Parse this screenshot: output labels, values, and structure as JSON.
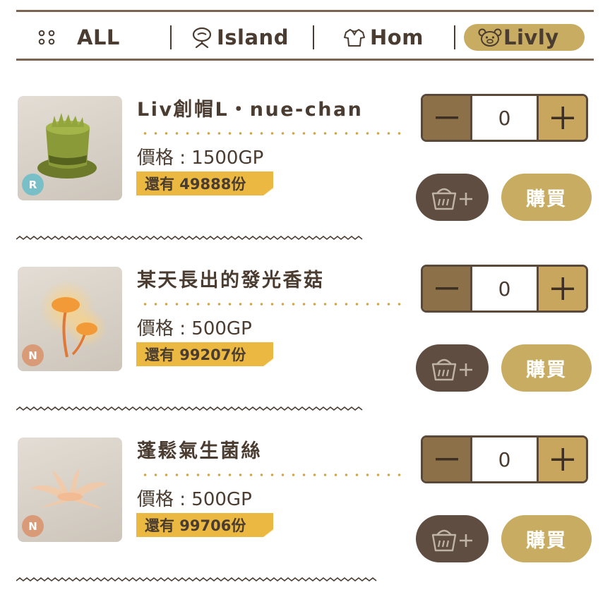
{
  "tabs": [
    {
      "label": "ALL",
      "icon": "dots-grid-icon",
      "active": false
    },
    {
      "label": "Island",
      "icon": "tree-icon",
      "active": false
    },
    {
      "label": "Hom",
      "icon": "shirt-icon",
      "active": false
    },
    {
      "label": "Livly",
      "icon": "livly-face-icon",
      "active": true
    }
  ],
  "items": [
    {
      "name": "Liv創帽L・nue-chan",
      "price": "價格 : 1500GP",
      "stock": "還有 49888份",
      "rarity": "R",
      "rarity_color": "#79bfc7",
      "quantity": "0",
      "buy_label": "購買",
      "image": "moss-top-hat"
    },
    {
      "name": "某天長出的發光香菇",
      "price": "價格 : 500GP",
      "stock": "還有 99207份",
      "rarity": "N",
      "rarity_color": "#d99a78",
      "quantity": "0",
      "buy_label": "購買",
      "image": "glowing-mushroom"
    },
    {
      "name": "蓬鬆氣生菌絲",
      "price": "價格 : 500GP",
      "stock": "還有 99706份",
      "rarity": "N",
      "rarity_color": "#d99a78",
      "quantity": "0",
      "buy_label": "購買",
      "image": "fluffy-mycelium"
    }
  ],
  "colors": {
    "accent_gold": "#c8ac62",
    "dark_brown": "#5e4d40",
    "stock_yellow": "#ebb941",
    "text": "#4a3c30"
  }
}
